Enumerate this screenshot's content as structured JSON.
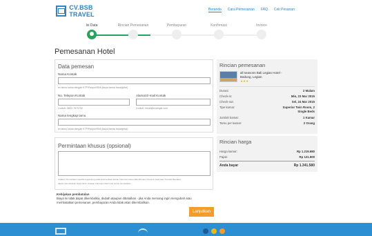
{
  "header": {
    "logo_text": "CV.BSB TRAVEL",
    "nav": [
      "Beranda",
      "Cara Pemesanan",
      "FAQ",
      "Cek Pesanan"
    ]
  },
  "steps": [
    {
      "label": "Isi Data"
    },
    {
      "label": "Rincian Pemesanan"
    },
    {
      "label": "Pembayaran"
    },
    {
      "label": "Konfirmasi"
    },
    {
      "label": "Invoice"
    }
  ],
  "page_title": "Pemesanan Hotel",
  "data_pemesan": {
    "title": "Data pemesan",
    "nama_kontak_label": "Nama Kontak",
    "nama_kontak_hint": "ex:Isimu sama dengan KTP/Paspor/SIM (tanpa tanda baca/gelar)",
    "telepon_label": "No. Telepon Kontak",
    "telepon_hint": "Contoh: 0822-7573732",
    "email_label": "Alamat E-mail Kontak",
    "email_hint": "Contoh: email@example.com",
    "tamu_label": "Nama lengkap tamu",
    "tamu_hint": "ex:Isimu sama dengan KTP/Paspor/SIM (tanpa tanda baca/gelar)"
  },
  "permintaan": {
    "title": "Permintaan khusus (opsional)",
    "note1": "Catatan: Permintaan spesifik tergantung pada ketersediaan kamar hotel dan harus dikonfirmasi. Check-in awal atau Transfer Bandara",
    "note2": "dapat menimbulkan biaya lebih. Ditekan hubungi pihak hotel untuk memastikan."
  },
  "kebijakan": {
    "title": "Kebijakan pembatalan",
    "line1": "Biaya ini tidak dapat dikembalika, diubah ataupun dibatalkan - jika Anda memang ingin mengubah atau",
    "line2": "membatalkan pemesanan, pembayaran Anda tidak akan dikembalikan."
  },
  "button_label": "Lanjutkan",
  "rincian": {
    "title": "Rincian pemesanan",
    "hotel_name_line1": "all seasons Bali Legian Hotel -",
    "hotel_name_line2": "Badung, Legian",
    "stars": "★★★",
    "rows": [
      {
        "k": "Durasi:",
        "v": "2 Malam"
      },
      {
        "k": "Check-in:",
        "v": "Min, 23 Mar 2015"
      },
      {
        "k": "Check-out:",
        "v": "Sel, 24 Mar 2015"
      },
      {
        "k": "Tipe kamar:",
        "v": "Superior Twin Room, 2"
      },
      {
        "k": "",
        "v": "Single Beds"
      },
      {
        "k": "Jumlah kamar:",
        "v": "1 Kamar"
      },
      {
        "k": "Tamu per kamar:",
        "v": "2 Orang"
      }
    ]
  },
  "harga": {
    "title": "Rincian harga",
    "rows": [
      {
        "k": "Harga kamar:",
        "v": "Rp 1.219.680"
      },
      {
        "k": "Pajak:",
        "v": "Rp 121.900"
      }
    ],
    "total_k": "Anda bayar",
    "total_v": "Rp 1.341.580"
  },
  "colors": {
    "accent": "#2f84c6",
    "success": "#29a35a",
    "button": "#f39c2b",
    "footer": "#2b8fd1"
  }
}
